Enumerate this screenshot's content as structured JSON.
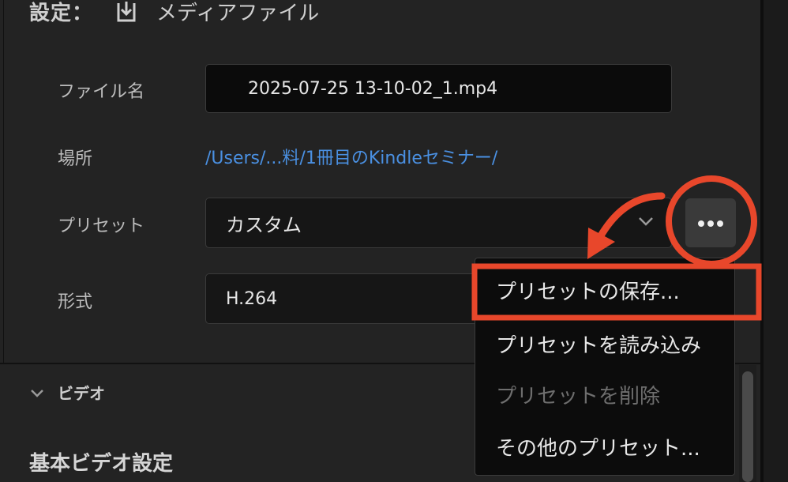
{
  "header": {
    "settings_label": "設定：",
    "media_label": "メディアファイル",
    "icon": "download-icon"
  },
  "fields": {
    "filename": {
      "label": "ファイル名",
      "value": "2025-07-25 13-10-02_1.mp4"
    },
    "location": {
      "label": "場所",
      "value": "/Users/...料/1冊目のKindleセミナー/"
    },
    "preset": {
      "label": "プリセット",
      "value": "カスタム"
    },
    "format": {
      "label": "形式",
      "value": "H.264"
    }
  },
  "more_button": {
    "icon": "more-icon"
  },
  "dropdown_menu": {
    "items": [
      {
        "label": "プリセットの保存...",
        "enabled": true,
        "highlighted": true
      },
      {
        "label": "プリセットを読み込み",
        "enabled": true
      },
      {
        "label": "プリセットを削除",
        "enabled": false
      },
      {
        "label": "その他のプリセット...",
        "enabled": true
      }
    ]
  },
  "sections": {
    "video": "ビデオ",
    "basic_video_settings": "基本ビデオ設定"
  },
  "colors": {
    "annotation": "#e8472b",
    "link": "#4a90e2",
    "panel_bg": "#232323"
  }
}
